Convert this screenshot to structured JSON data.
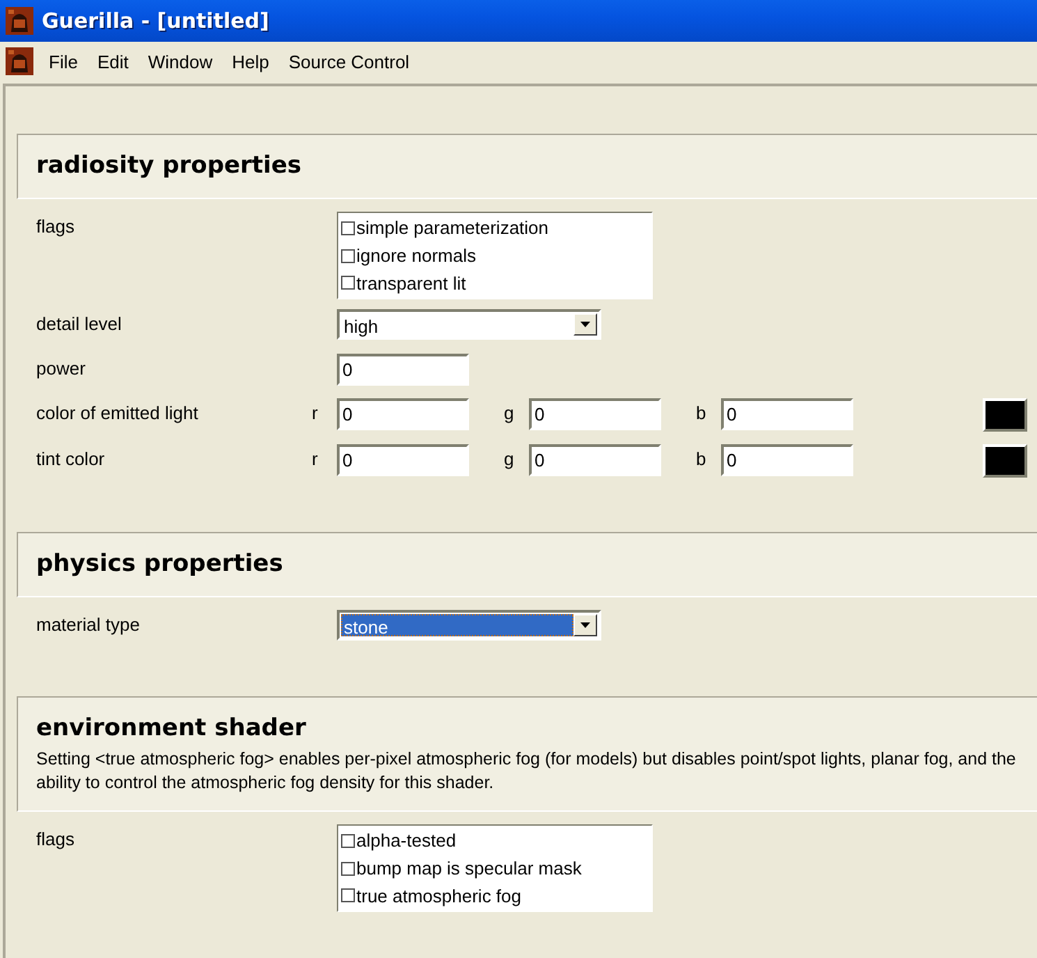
{
  "window": {
    "title": "Guerilla - [untitled]"
  },
  "menu": [
    "File",
    "Edit",
    "Window",
    "Help",
    "Source Control"
  ],
  "sections": [
    {
      "title": "radiosity properties",
      "rows": [
        {
          "kind": "checklist",
          "label": "flags",
          "options": [
            {
              "label": "simple parameterization",
              "checked": false
            },
            {
              "label": "ignore normals",
              "checked": false
            },
            {
              "label": "transparent lit",
              "checked": false
            }
          ]
        },
        {
          "kind": "dropdown",
          "label": "detail level",
          "value": "high",
          "focused": false
        },
        {
          "kind": "text",
          "label": "power",
          "value": "0"
        },
        {
          "kind": "color",
          "label": "color of emitted light",
          "channels": [
            {
              "name": "r",
              "value": "0"
            },
            {
              "name": "g",
              "value": "0"
            },
            {
              "name": "b",
              "value": "0"
            }
          ],
          "color": "#000000"
        },
        {
          "kind": "color",
          "label": "tint color",
          "channels": [
            {
              "name": "r",
              "value": "0"
            },
            {
              "name": "g",
              "value": "0"
            },
            {
              "name": "b",
              "value": "0"
            }
          ],
          "color": "#000000"
        }
      ]
    },
    {
      "title": "physics properties",
      "rows": [
        {
          "kind": "dropdown",
          "label": "material type",
          "value": "stone",
          "focused": true
        }
      ]
    },
    {
      "title": "environment shader",
      "description": "Setting <true atmospheric fog> enables per-pixel atmospheric fog (for models) but disables point/spot lights, planar fog, and the ability to control the atmospheric fog density for this shader.",
      "rows": [
        {
          "kind": "checklist",
          "label": "flags",
          "options": [
            {
              "label": "alpha-tested",
              "checked": false
            },
            {
              "label": "bump map is specular mask",
              "checked": false
            },
            {
              "label": "true atmospheric fog",
              "checked": false
            }
          ]
        }
      ]
    }
  ]
}
